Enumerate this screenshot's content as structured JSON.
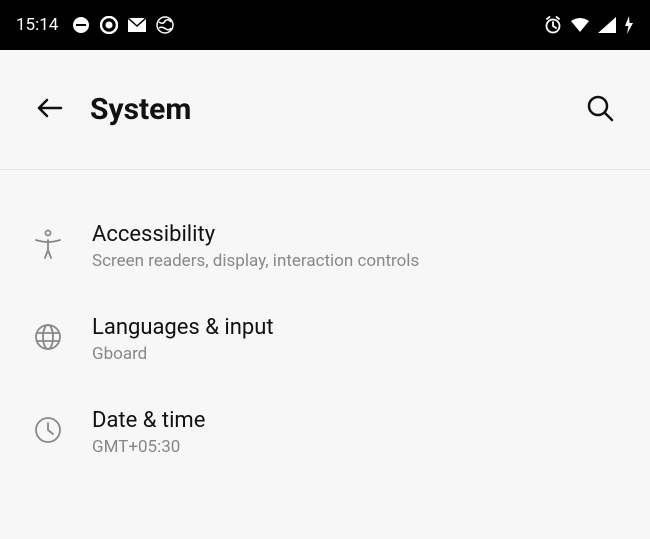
{
  "status": {
    "time": "15:14"
  },
  "header": {
    "title": "System"
  },
  "items": [
    {
      "title": "Accessibility",
      "sub": "Screen readers, display, interaction controls"
    },
    {
      "title": "Languages & input",
      "sub": "Gboard"
    },
    {
      "title": "Date & time",
      "sub": "GMT+05:30"
    }
  ]
}
